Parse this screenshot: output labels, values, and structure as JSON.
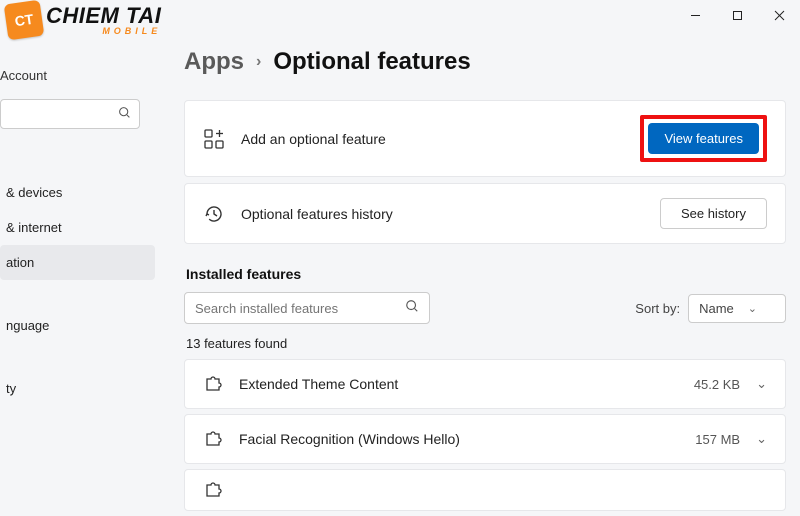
{
  "watermark": {
    "badge": "CT",
    "main": "CHIEM TAI",
    "sub": "MOBILE"
  },
  "sidebar": {
    "account_label": "Account",
    "nav": [
      {
        "label": "& devices"
      },
      {
        "label": "& internet"
      },
      {
        "label": "ation",
        "selected": true
      },
      {
        "label": "nguage"
      },
      {
        "label": "ty"
      }
    ]
  },
  "breadcrumb": {
    "parent": "Apps",
    "current": "Optional features"
  },
  "cards": {
    "add": {
      "label": "Add an optional feature",
      "button": "View features"
    },
    "history": {
      "label": "Optional features history",
      "button": "See history"
    }
  },
  "installed": {
    "title": "Installed features",
    "search_placeholder": "Search installed features",
    "sort_label": "Sort by:",
    "sort_value": "Name",
    "count_text": "13 features found",
    "items": [
      {
        "name": "Extended Theme Content",
        "size": "45.2 KB"
      },
      {
        "name": "Facial Recognition (Windows Hello)",
        "size": "157 MB"
      }
    ]
  }
}
